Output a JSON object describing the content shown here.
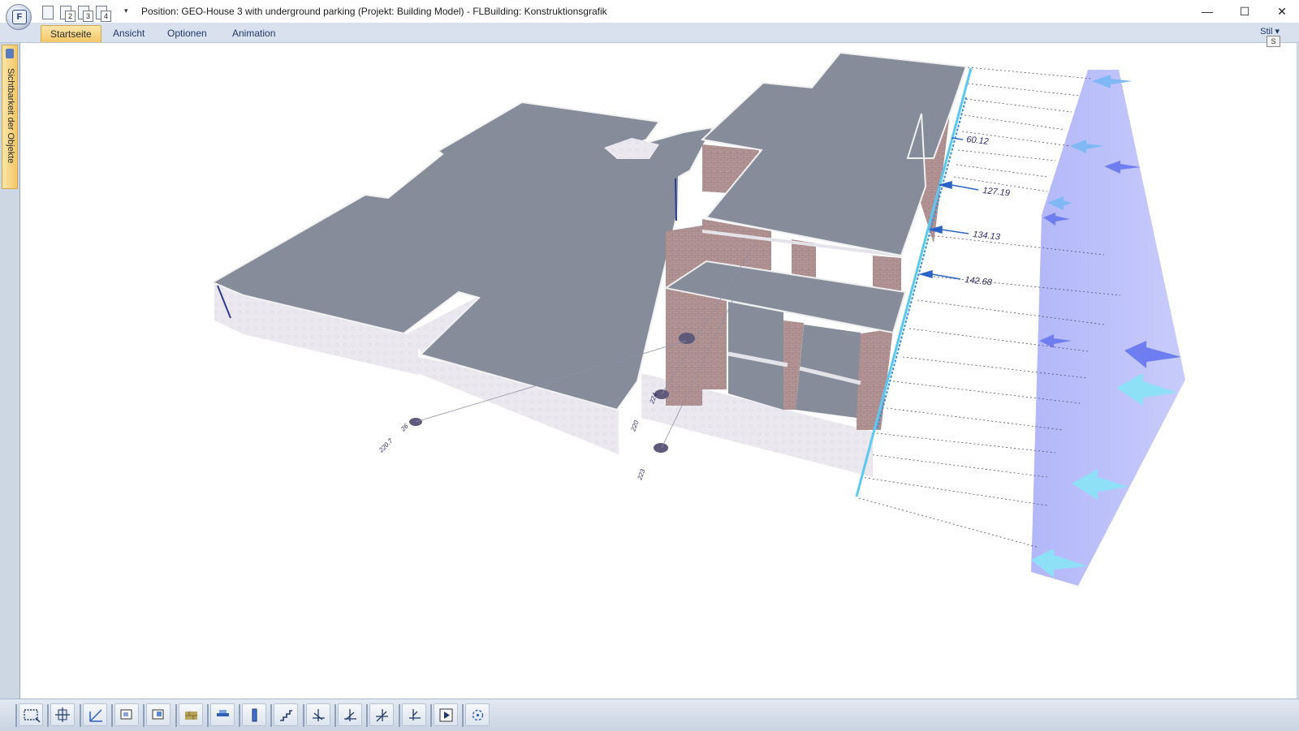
{
  "window": {
    "title": "Position: GEO-House 3 with underground parking (Projekt: Building Model) - FLBuilding: Konstruktionsgrafik",
    "app_letter": "F",
    "minimize": "—",
    "maximize": "☐",
    "close": "✕"
  },
  "quick_access": {
    "items": [
      {
        "icon": "document-icon",
        "number": ""
      },
      {
        "icon": "document-2-icon",
        "number": "2"
      },
      {
        "icon": "document-3-icon",
        "number": "3"
      },
      {
        "icon": "document-4-icon",
        "number": "4"
      }
    ],
    "more": "▾"
  },
  "ribbon": {
    "tabs": [
      {
        "label": "Startseite",
        "active": true
      },
      {
        "label": "Ansicht",
        "active": false
      },
      {
        "label": "Optionen",
        "active": false
      },
      {
        "label": "Animation",
        "active": false
      }
    ],
    "style_menu": "Stil ▾",
    "style_key": "S"
  },
  "side_panel": {
    "tab_label": "Sichtbarkeit der Objekte"
  },
  "viewport": {
    "wind_labels": [
      "60.12",
      "127.19",
      "134.13",
      "142.68"
    ],
    "small_labels": [
      "220.7",
      "26",
      "220",
      "223",
      "224"
    ],
    "colors": {
      "roof": "#878c9a",
      "wall_brick": "#b08a8c",
      "wall_light": "#ebe8ef",
      "wind_panel": "#b9befa",
      "accent_line": "#5bc8f0"
    }
  },
  "toolbar": {
    "buttons": [
      {
        "name": "select-rect-icon",
        "tip": "Rechteck"
      },
      {
        "name": "pan-icon",
        "tip": "Verschieben"
      },
      {
        "name": "axis-icon",
        "tip": "Achsen"
      },
      {
        "name": "view-front-icon",
        "tip": "Ansicht 1"
      },
      {
        "name": "view-side-icon",
        "tip": "Ansicht 2"
      },
      {
        "name": "wall-icon",
        "tip": "Wand"
      },
      {
        "name": "slab-icon",
        "tip": "Decke"
      },
      {
        "name": "column-icon",
        "tip": "Stütze"
      },
      {
        "name": "stairs-icon",
        "tip": "Treppe"
      },
      {
        "name": "dimension-1-icon",
        "tip": "Maß 1"
      },
      {
        "name": "dimension-2-icon",
        "tip": "Maß 2"
      },
      {
        "name": "dimension-3-icon",
        "tip": "Maß 3"
      },
      {
        "name": "rotate-icon",
        "tip": "Drehen"
      },
      {
        "name": "play-icon",
        "tip": "Abspielen"
      },
      {
        "name": "orbit-icon",
        "tip": "Orbit"
      }
    ]
  }
}
